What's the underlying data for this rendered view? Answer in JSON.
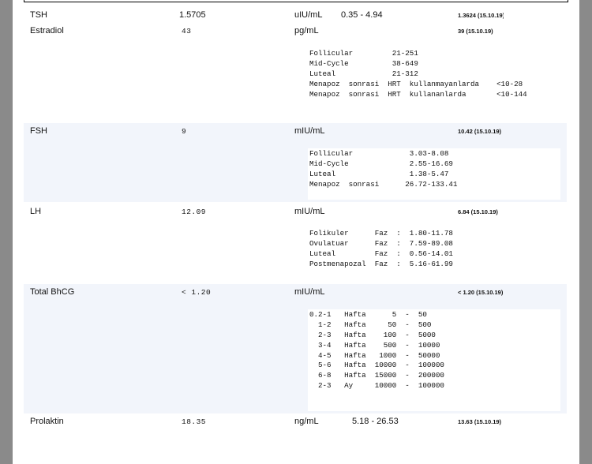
{
  "tests": [
    {
      "name": "TSH",
      "value": "1.5705",
      "unit": "uIU/mL",
      "range": "0.35  -  4.94",
      "previous": "1.3624  (15.10.19)",
      "reference": []
    },
    {
      "name": "Estradiol",
      "value": "43",
      "unit": "pg/mL",
      "range": "",
      "previous": "39  (15.10.19)",
      "reference": [
        "Follicular         21-251",
        "Mid-Cycle          38-649",
        "Luteal             21-312",
        "Menapoz  sonrasi  HRT  kullanmayanlarda    <10-28",
        "Menapoz  sonrasi  HRT  kullananlarda       <10-144"
      ]
    },
    {
      "name": "FSH",
      "value": "9",
      "unit": "mIU/mL",
      "range": "",
      "previous": "10.42  (15.10.19)",
      "reference": [
        "Follicular             3.03-8.08",
        "Mid-Cycle              2.55-16.69",
        "Luteal                 1.38-5.47",
        "Menapoz  sonrasi      26.72-133.41"
      ]
    },
    {
      "name": "LH",
      "value": "12.09",
      "unit": "mIU/mL",
      "range": "",
      "previous": "6.84  (15.10.19)",
      "reference": [
        "Folikuler      Faz  :  1.80-11.78",
        "Ovulatuar      Faz  :  7.59-89.08",
        "Luteal         Faz  :  0.56-14.01",
        "Postmenapozal  Faz  :  5.16-61.99"
      ]
    },
    {
      "name": "Total BhCG",
      "value": "<  1.20",
      "unit": "mIU/mL",
      "range": "",
      "previous": "< 1.20  (15.10.19)",
      "reference": [
        "0.2-1   Hafta      5  -  50",
        "  1-2   Hafta     50  -  500",
        "  2-3   Hafta    100  -  5000",
        "  3-4   Hafta    500  -  10000",
        "  4-5   Hafta   1000  -  50000",
        "  5-6   Hafta  10000  -  100000",
        "  6-8   Hafta  15000  -  200000",
        "  2-3   Ay     10000  -  100000"
      ]
    },
    {
      "name": "Prolaktin",
      "value": "18.35",
      "unit": "ng/mL",
      "range": "5.18  -  26.53",
      "previous": "13.63  (15.10.19)",
      "reference": []
    }
  ]
}
